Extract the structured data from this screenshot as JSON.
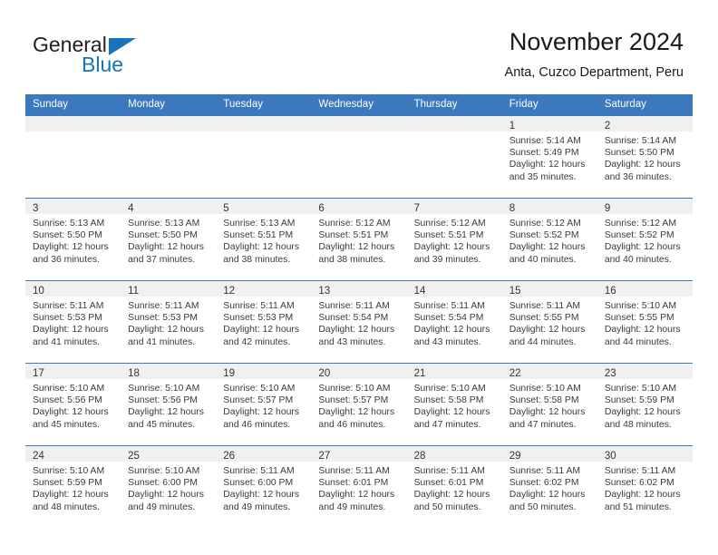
{
  "brand": {
    "name_part1": "General",
    "name_part2": "Blue",
    "triangle_color": "#1574bb",
    "text_color": "#231f20"
  },
  "header": {
    "title": "November 2024",
    "subtitle": "Anta, Cuzco Department, Peru"
  },
  "theme": {
    "header_blue": "#3c78be",
    "daynum_band": "#f0f0f0",
    "page_background": "#ffffff"
  },
  "weekday_headers": [
    "Sunday",
    "Monday",
    "Tuesday",
    "Wednesday",
    "Thursday",
    "Friday",
    "Saturday"
  ],
  "weeks": [
    [
      {
        "day": "",
        "lines": []
      },
      {
        "day": "",
        "lines": []
      },
      {
        "day": "",
        "lines": []
      },
      {
        "day": "",
        "lines": []
      },
      {
        "day": "",
        "lines": []
      },
      {
        "day": "1",
        "lines": [
          "Sunrise: 5:14 AM",
          "Sunset: 5:49 PM",
          "Daylight: 12 hours",
          "and 35 minutes."
        ]
      },
      {
        "day": "2",
        "lines": [
          "Sunrise: 5:14 AM",
          "Sunset: 5:50 PM",
          "Daylight: 12 hours",
          "and 36 minutes."
        ]
      }
    ],
    [
      {
        "day": "3",
        "lines": [
          "Sunrise: 5:13 AM",
          "Sunset: 5:50 PM",
          "Daylight: 12 hours",
          "and 36 minutes."
        ]
      },
      {
        "day": "4",
        "lines": [
          "Sunrise: 5:13 AM",
          "Sunset: 5:50 PM",
          "Daylight: 12 hours",
          "and 37 minutes."
        ]
      },
      {
        "day": "5",
        "lines": [
          "Sunrise: 5:13 AM",
          "Sunset: 5:51 PM",
          "Daylight: 12 hours",
          "and 38 minutes."
        ]
      },
      {
        "day": "6",
        "lines": [
          "Sunrise: 5:12 AM",
          "Sunset: 5:51 PM",
          "Daylight: 12 hours",
          "and 38 minutes."
        ]
      },
      {
        "day": "7",
        "lines": [
          "Sunrise: 5:12 AM",
          "Sunset: 5:51 PM",
          "Daylight: 12 hours",
          "and 39 minutes."
        ]
      },
      {
        "day": "8",
        "lines": [
          "Sunrise: 5:12 AM",
          "Sunset: 5:52 PM",
          "Daylight: 12 hours",
          "and 40 minutes."
        ]
      },
      {
        "day": "9",
        "lines": [
          "Sunrise: 5:12 AM",
          "Sunset: 5:52 PM",
          "Daylight: 12 hours",
          "and 40 minutes."
        ]
      }
    ],
    [
      {
        "day": "10",
        "lines": [
          "Sunrise: 5:11 AM",
          "Sunset: 5:53 PM",
          "Daylight: 12 hours",
          "and 41 minutes."
        ]
      },
      {
        "day": "11",
        "lines": [
          "Sunrise: 5:11 AM",
          "Sunset: 5:53 PM",
          "Daylight: 12 hours",
          "and 41 minutes."
        ]
      },
      {
        "day": "12",
        "lines": [
          "Sunrise: 5:11 AM",
          "Sunset: 5:53 PM",
          "Daylight: 12 hours",
          "and 42 minutes."
        ]
      },
      {
        "day": "13",
        "lines": [
          "Sunrise: 5:11 AM",
          "Sunset: 5:54 PM",
          "Daylight: 12 hours",
          "and 43 minutes."
        ]
      },
      {
        "day": "14",
        "lines": [
          "Sunrise: 5:11 AM",
          "Sunset: 5:54 PM",
          "Daylight: 12 hours",
          "and 43 minutes."
        ]
      },
      {
        "day": "15",
        "lines": [
          "Sunrise: 5:11 AM",
          "Sunset: 5:55 PM",
          "Daylight: 12 hours",
          "and 44 minutes."
        ]
      },
      {
        "day": "16",
        "lines": [
          "Sunrise: 5:10 AM",
          "Sunset: 5:55 PM",
          "Daylight: 12 hours",
          "and 44 minutes."
        ]
      }
    ],
    [
      {
        "day": "17",
        "lines": [
          "Sunrise: 5:10 AM",
          "Sunset: 5:56 PM",
          "Daylight: 12 hours",
          "and 45 minutes."
        ]
      },
      {
        "day": "18",
        "lines": [
          "Sunrise: 5:10 AM",
          "Sunset: 5:56 PM",
          "Daylight: 12 hours",
          "and 45 minutes."
        ]
      },
      {
        "day": "19",
        "lines": [
          "Sunrise: 5:10 AM",
          "Sunset: 5:57 PM",
          "Daylight: 12 hours",
          "and 46 minutes."
        ]
      },
      {
        "day": "20",
        "lines": [
          "Sunrise: 5:10 AM",
          "Sunset: 5:57 PM",
          "Daylight: 12 hours",
          "and 46 minutes."
        ]
      },
      {
        "day": "21",
        "lines": [
          "Sunrise: 5:10 AM",
          "Sunset: 5:58 PM",
          "Daylight: 12 hours",
          "and 47 minutes."
        ]
      },
      {
        "day": "22",
        "lines": [
          "Sunrise: 5:10 AM",
          "Sunset: 5:58 PM",
          "Daylight: 12 hours",
          "and 47 minutes."
        ]
      },
      {
        "day": "23",
        "lines": [
          "Sunrise: 5:10 AM",
          "Sunset: 5:59 PM",
          "Daylight: 12 hours",
          "and 48 minutes."
        ]
      }
    ],
    [
      {
        "day": "24",
        "lines": [
          "Sunrise: 5:10 AM",
          "Sunset: 5:59 PM",
          "Daylight: 12 hours",
          "and 48 minutes."
        ]
      },
      {
        "day": "25",
        "lines": [
          "Sunrise: 5:10 AM",
          "Sunset: 6:00 PM",
          "Daylight: 12 hours",
          "and 49 minutes."
        ]
      },
      {
        "day": "26",
        "lines": [
          "Sunrise: 5:11 AM",
          "Sunset: 6:00 PM",
          "Daylight: 12 hours",
          "and 49 minutes."
        ]
      },
      {
        "day": "27",
        "lines": [
          "Sunrise: 5:11 AM",
          "Sunset: 6:01 PM",
          "Daylight: 12 hours",
          "and 49 minutes."
        ]
      },
      {
        "day": "28",
        "lines": [
          "Sunrise: 5:11 AM",
          "Sunset: 6:01 PM",
          "Daylight: 12 hours",
          "and 50 minutes."
        ]
      },
      {
        "day": "29",
        "lines": [
          "Sunrise: 5:11 AM",
          "Sunset: 6:02 PM",
          "Daylight: 12 hours",
          "and 50 minutes."
        ]
      },
      {
        "day": "30",
        "lines": [
          "Sunrise: 5:11 AM",
          "Sunset: 6:02 PM",
          "Daylight: 12 hours",
          "and 51 minutes."
        ]
      }
    ]
  ]
}
